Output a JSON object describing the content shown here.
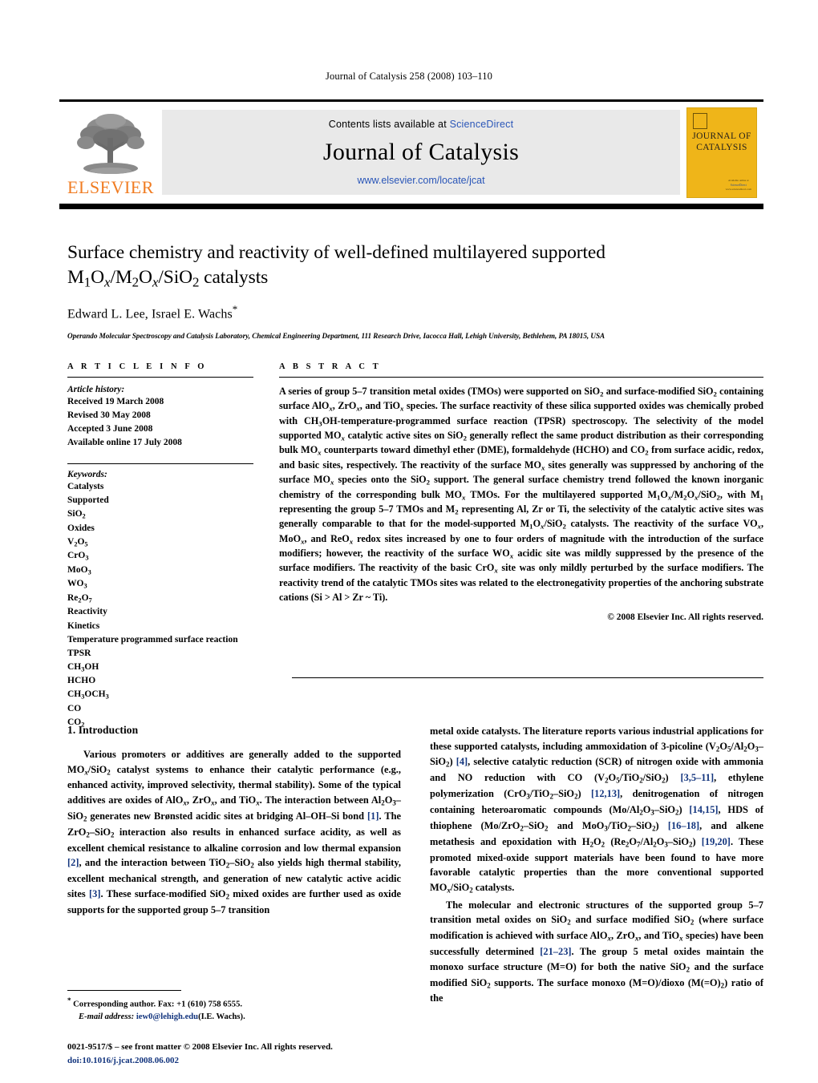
{
  "running_head": "Journal of Catalysis 258 (2008) 103–110",
  "masthead": {
    "contents_prefix": "Contents lists available at",
    "contents_link": "ScienceDirect",
    "journal_name": "Journal of Catalysis",
    "journal_url": "www.elsevier.com/locate/jcat",
    "publisher_name": "ELSEVIER",
    "publisher_logo_icon": "elsevier-tree-icon",
    "cover": {
      "line1": "JOURNAL OF",
      "line2": "CATALYSIS",
      "footer_line1": "Available online at",
      "footer_line2": "ScienceDirect",
      "footer_line3": "www.sciencedirect.com",
      "color": "#EFB519"
    }
  },
  "article": {
    "title_line1": "Surface chemistry and reactivity of well-defined multilayered supported",
    "title_line2_pre": "M",
    "title_sub1": "1",
    "title_o": "O",
    "title_subx1": "x",
    "title_slash1": "/M",
    "title_sub2": "2",
    "title_o2": "O",
    "title_subx2": "x",
    "title_slash2": "/SiO",
    "title_sub3": "2",
    "title_tail": " catalysts",
    "authors": "Edward L. Lee, Israel E. Wachs",
    "corresponding_marker": "*",
    "affiliation": "Operando Molecular Spectroscopy and Catalysis Laboratory, Chemical Engineering Department, 111 Research Drive, Iacocca Hall, Lehigh University, Bethlehem, PA 18015, USA"
  },
  "article_info": {
    "section_label": "A R T I C L E    I N F O",
    "history_title": "Article history:",
    "history": [
      "Received 19 March 2008",
      "Revised 30 May 2008",
      "Accepted 3 June 2008",
      "Available online 17 July 2008"
    ],
    "keywords_title": "Keywords:",
    "keywords": [
      "Catalysts",
      "Supported",
      "SiO2",
      "Oxides",
      "V2O5",
      "CrO3",
      "MoO3",
      "WO3",
      "Re2O7",
      "Reactivity",
      "Kinetics",
      "Temperature programmed surface reaction",
      "TPSR",
      "CH3OH",
      "HCHO",
      "CH3OCH3",
      "CO",
      "CO2"
    ]
  },
  "abstract": {
    "section_label": "A B S T R A C T",
    "text": "A series of group 5–7 transition metal oxides (TMOs) were supported on SiO2 and surface-modified SiO2 containing surface AlOx, ZrOx, and TiOx species. The surface reactivity of these silica supported oxides was chemically probed with CH3OH-temperature-programmed surface reaction (TPSR) spectroscopy. The selectivity of the model supported MOx catalytic active sites on SiO2 generally reflect the same product distribution as their corresponding bulk MOx counterparts toward dimethyl ether (DME), formaldehyde (HCHO) and CO2 from surface acidic, redox, and basic sites, respectively. The reactivity of the surface MOx sites generally was suppressed by anchoring of the surface MOx species onto the SiO2 support. The general surface chemistry trend followed the known inorganic chemistry of the corresponding bulk MOx TMOs. For the multilayered supported M1Ox/M2Ox/SiO2, with M1 representing the group 5–7 TMOs and M2 representing Al, Zr or Ti, the selectivity of the catalytic active sites was generally comparable to that for the model-supported M1Ox/SiO2 catalysts. The reactivity of the surface VOx, MoOx, and ReOx redox sites increased by one to four orders of magnitude with the introduction of the surface modifiers; however, the reactivity of the surface WOx acidic site was mildly suppressed by the presence of the surface modifiers. The reactivity of the basic CrOx site was only mildly perturbed by the surface modifiers. The reactivity trend of the catalytic TMOs sites was related to the electronegativity properties of the anchoring substrate cations (Si > Al > Zr ~ Ti).",
    "copyright": "© 2008 Elsevier Inc. All rights reserved."
  },
  "introduction": {
    "heading": "1. Introduction",
    "left_paragraph": "Various promoters or additives are generally added to the supported MOx/SiO2 catalyst systems to enhance their catalytic performance (e.g., enhanced activity, improved selectivity, thermal stability). Some of the typical additives are oxides of AlOx, ZrOx, and TiOx. The interaction between Al2O3–SiO2 generates new Brønsted acidic sites at bridging Al–OH–Si bond [1]. The ZrO2–SiO2 interaction also results in enhanced surface acidity, as well as excellent chemical resistance to alkaline corrosion and low thermal expansion [2], and the interaction between TiO2–SiO2 also yields high thermal stability, excellent mechanical strength, and generation of new catalytic active acidic sites [3]. These surface-modified SiO2 mixed oxides are further used as oxide supports for the supported group 5–7 transition",
    "right_paragraph_1": "metal oxide catalysts. The literature reports various industrial applications for these supported catalysts, including ammoxidation of 3-picoline (V2O5/Al2O3–SiO2) [4], selective catalytic reduction (SCR) of nitrogen oxide with ammonia and NO reduction with CO (V2O5/TiO2/SiO2) [3,5–11], ethylene polymerization (CrO3/TiO2–SiO2) [12,13], denitrogenation of nitrogen containing heteroaromatic compounds (Mo/Al2O3–SiO2) [14,15], HDS of thiophene (Mo/ZrO2–SiO2 and MoO3/TiO2–SiO2) [16–18], and alkene metathesis and epoxidation with H2O2 (Re2O7/Al2O3–SiO2) [19,20]. These promoted mixed-oxide support materials have been found to have more favorable catalytic properties than the more conventional supported MOx/SiO2 catalysts.",
    "right_paragraph_2": "The molecular and electronic structures of the supported group 5–7 transition metal oxides on SiO2 and surface modified SiO2 (where surface modification is achieved with surface AlOx, ZrOx, and TiOx species) have been successfully determined [21–23]. The group 5 metal oxides maintain the monoxo surface structure (M=O) for both the native SiO2 and the surface modified SiO2 supports. The surface monoxo (M=O)/dioxo (M(=O)2) ratio of the"
  },
  "footnote": {
    "marker": "*",
    "corresponding": "Corresponding author. Fax: +1 (610) 758 6555.",
    "email_label": "E-mail address:",
    "email": "iew0@lehigh.edu",
    "email_owner": "(I.E. Wachs)."
  },
  "imprint": {
    "issn_line": "0021-9517/$ – see front matter © 2008 Elsevier Inc. All rights reserved.",
    "doi": "doi:10.1016/j.jcat.2008.06.002"
  }
}
